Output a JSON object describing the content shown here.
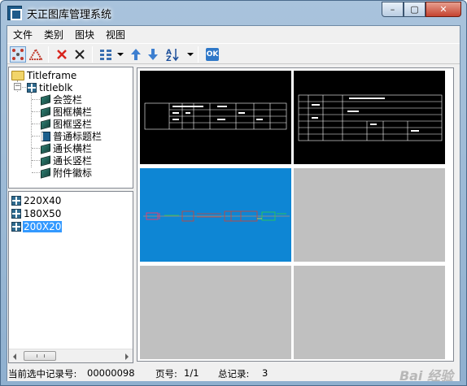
{
  "window": {
    "title": "天正图库管理系统"
  },
  "window_controls": [
    "–",
    "▢",
    "✕"
  ],
  "menu": {
    "items": [
      "文件",
      "类别",
      "图块",
      "视图"
    ]
  },
  "tree": {
    "root": "Titleframe",
    "group": "titleblk",
    "children": [
      "会签栏",
      "图框横栏",
      "图框竖栏",
      "普通标题栏",
      "通长横栏",
      "通长竖栏",
      "附件徽标"
    ]
  },
  "list": {
    "items": [
      "220X40",
      "180X50",
      "200X20"
    ],
    "selected_index": 2
  },
  "statusbar": {
    "record_label": "当前选中记录号:",
    "record_value": "00000098",
    "page_label": "页号:",
    "page_value": "1/1",
    "total_label": "总记录:",
    "total_value": "3"
  },
  "watermark": "Bai 经验",
  "colors": {
    "preview_selected": "#0e86d4",
    "preview_black": "#000000",
    "preview_empty": "#c0c0c0",
    "list_selection": "#3399ff"
  }
}
